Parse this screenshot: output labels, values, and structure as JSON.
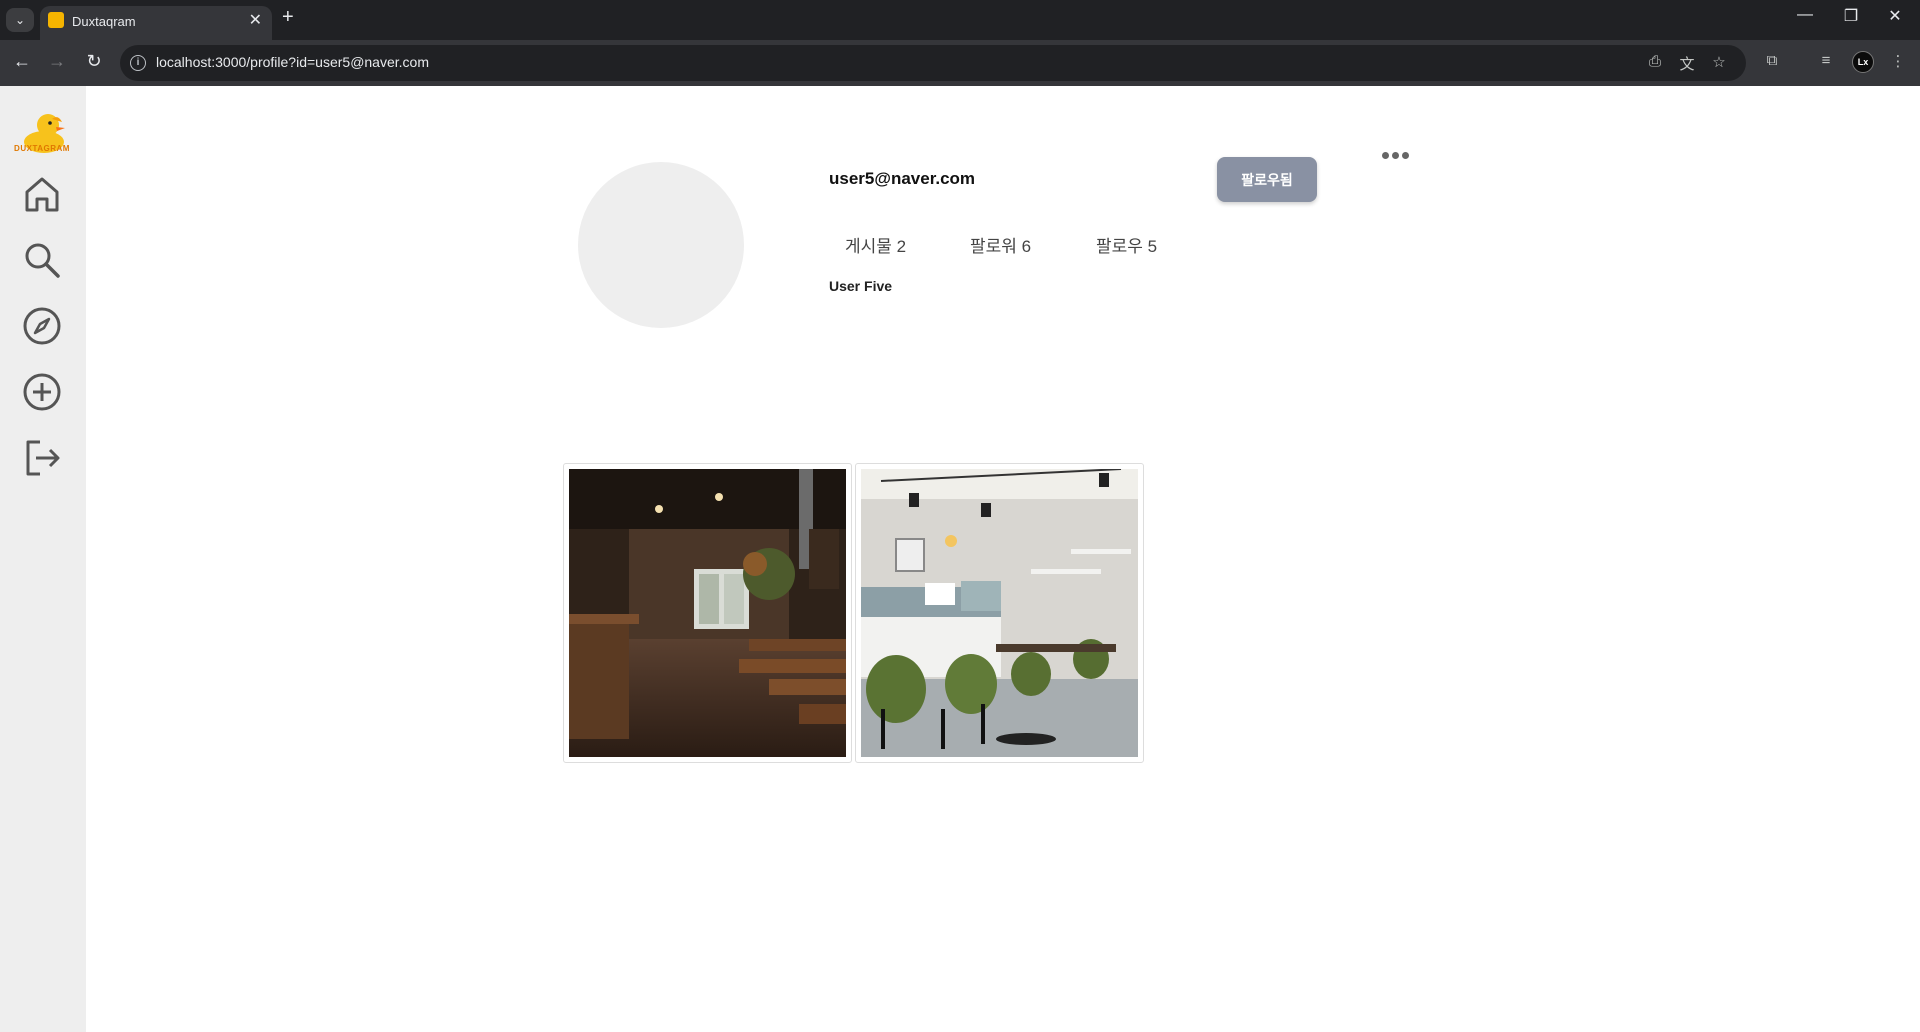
{
  "browser": {
    "tab_title": "Duxtaqram",
    "url": "localhost:3000/profile?id=user5@naver.com",
    "profile_initials": "Lx"
  },
  "app": {
    "brand": "DUXTAGRAM",
    "brand_color": "#e07800",
    "sidebar_items": [
      {
        "icon": "home-icon"
      },
      {
        "icon": "search-icon"
      },
      {
        "icon": "explore-compass-icon"
      },
      {
        "icon": "create-post-icon"
      },
      {
        "icon": "logout-icon"
      }
    ]
  },
  "profile": {
    "username": "user5@naver.com",
    "follow_button_label": "팔로우됨",
    "follow_button_color": "#8991a3",
    "stats": {
      "posts": "게시물 2",
      "followers": "팔로워 6",
      "following": "팔로우 5"
    },
    "display_name": "User Five"
  },
  "posts": [
    {
      "description": "cafe-interior-dark-wood"
    },
    {
      "description": "cafe-interior-green-chairs"
    }
  ]
}
